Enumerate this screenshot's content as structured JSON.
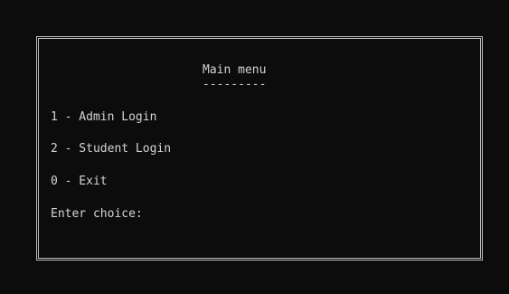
{
  "menu": {
    "title": "Main menu",
    "underline": "---------",
    "items": [
      {
        "label": "1 - Admin Login"
      },
      {
        "label": "2 - Student Login"
      },
      {
        "label": "0 - Exit"
      }
    ],
    "prompt": "Enter choice:"
  },
  "colors": {
    "background": "#0c0c0c",
    "text": "#d4d4d4",
    "border": "#bdbdbd"
  }
}
